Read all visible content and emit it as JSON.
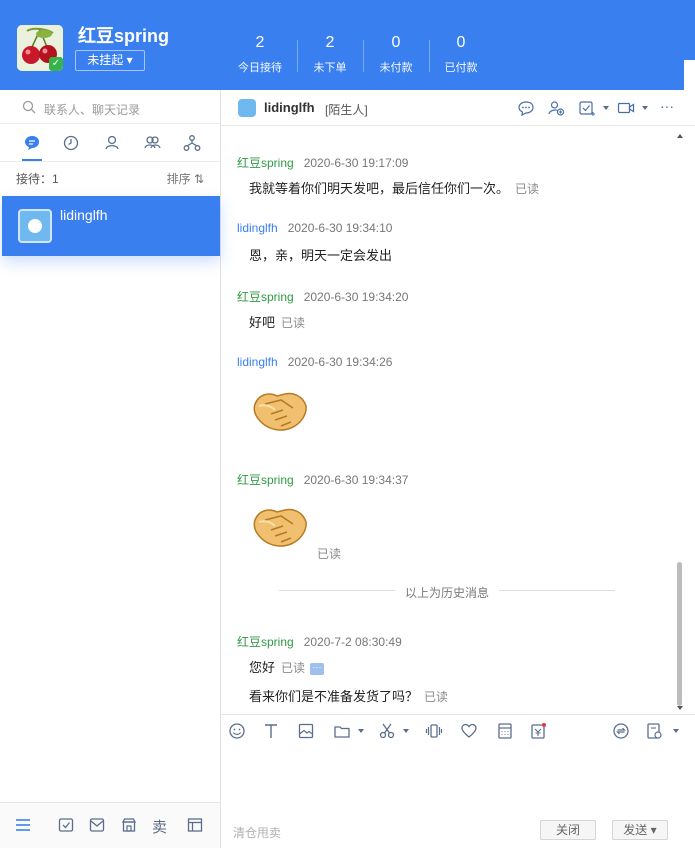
{
  "header": {
    "shop_name": "红豆spring",
    "status": "未挂起",
    "stats": [
      {
        "value": "2",
        "label": "今日接待"
      },
      {
        "value": "2",
        "label": "未下单"
      },
      {
        "value": "0",
        "label": "未付款"
      },
      {
        "value": "0",
        "label": "已付款"
      }
    ],
    "colors": {
      "primary": "#3a7ff0",
      "me": "#2f9a43",
      "them": "#3a7ff0"
    }
  },
  "sidebar": {
    "search_placeholder": "联系人、聊天记录",
    "tabs": [
      "chat-icon",
      "recent-icon",
      "contact-icon",
      "group-icon",
      "team-icon"
    ],
    "queue_label": "接待：1",
    "sort_label": "排序 ⇅",
    "sessions": [
      {
        "name": "lidinglfh"
      }
    ],
    "bottom_text_icon": "卖"
  },
  "chat": {
    "title": "lidinglfh",
    "tag": "[陌生人]",
    "messages": [
      {
        "sender": "红豆spring",
        "time": "2020-6-30 19:17:09",
        "text": "我就等着你们明天发吧，最后信任你们一次。",
        "read": "已读"
      },
      {
        "sender": "lidinglfh",
        "time": "2020-6-30 19:34:10",
        "text": "恩，亲，明天一定会发出"
      },
      {
        "sender": "红豆spring",
        "time": "2020-6-30 19:34:20",
        "text": "好吧",
        "read": "已读"
      },
      {
        "sender": "lidinglfh",
        "time": "2020-6-30 19:34:26",
        "emoji": "handshake"
      },
      {
        "sender": "红豆spring",
        "time": "2020-6-30 19:34:37",
        "emoji": "handshake",
        "read": "已读"
      },
      {
        "sender": "红豆spring",
        "time": "2020-7-2 08:30:49",
        "text": "您好",
        "read": "已读"
      },
      {
        "text": "看来你们是不准备发货了吗？",
        "read": "已读"
      }
    ],
    "history_divider": "以上为历史消息"
  },
  "compose": {
    "clear_label": "清仓甩卖",
    "close_label": "关闭",
    "send_label": "发送"
  }
}
